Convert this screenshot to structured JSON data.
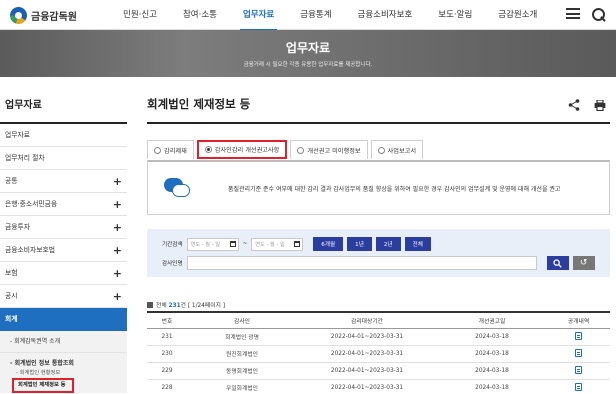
{
  "header": {
    "logo": "금융감독원",
    "nav": [
      "민원·신고",
      "참여·소통",
      "업무자료",
      "금융통계",
      "금융소비자보호",
      "보도·알림",
      "금감원소개"
    ]
  },
  "banner": {
    "title": "업무자료",
    "subtitle": "금융거래 시 필요한 각종 유용한 업무자료를 제공합니다."
  },
  "sidebar": {
    "title": "업무자료",
    "items": [
      {
        "label": "업무자료",
        "plus": ""
      },
      {
        "label": "업무처리 절차",
        "plus": ""
      },
      {
        "label": "공통",
        "plus": "+"
      },
      {
        "label": "은행·중소서민금융",
        "plus": "+"
      },
      {
        "label": "금융투자",
        "plus": "+"
      },
      {
        "label": "금융소비자보호법",
        "plus": "+"
      },
      {
        "label": "보험",
        "plus": "+"
      },
      {
        "label": "공시",
        "plus": "+"
      }
    ],
    "active": "회계",
    "sub": [
      {
        "label": "- 회계감독권역 소개"
      },
      {
        "label": "- 회계법인 정보 통합조회"
      }
    ],
    "subsub": [
      "- 회계법인 현황정보",
      "회계법인 제재정보 등"
    ]
  },
  "main": {
    "title": "회계법인 제재정보 등",
    "tabs": [
      "감리제재",
      "감사인감리 개선권고사항",
      "개선권고 미이행정보",
      "사업보고서"
    ],
    "info": "품질관리기준 준수 여부에 대한 감리 결과 감사업무의 품질 향상을 위하여 필요한 경우 감사인의 업무설계 및 운영에 대해 개선을 권고",
    "search": {
      "period_label": "기간검색",
      "date_placeholder": "연도 - 월 - 일",
      "tilde": "~",
      "periods": [
        "6개월",
        "1년",
        "2년",
        "전체"
      ],
      "auditor_label": "감사인명"
    },
    "count": {
      "prefix": "전체",
      "total": "231",
      "unit": "건",
      "pages": "[ 1/24페이지 ]"
    },
    "table": {
      "headers": [
        "번호",
        "감사인",
        "감리대상기간",
        "개선권고일",
        "공개내역"
      ],
      "rows": [
        [
          "231",
          "회계법인 광명",
          "2022-04-01~2023-03-31",
          "2024-03-18"
        ],
        [
          "230",
          "원진회계법인",
          "2022-04-01~2023-03-31",
          "2024-03-18"
        ],
        [
          "229",
          "동명회계법인",
          "2022-04-01~2023-03-31",
          "2024-03-18"
        ],
        [
          "228",
          "우일회계법인",
          "2022-04-01~2023-03-31",
          "2024-03-18"
        ]
      ]
    }
  }
}
